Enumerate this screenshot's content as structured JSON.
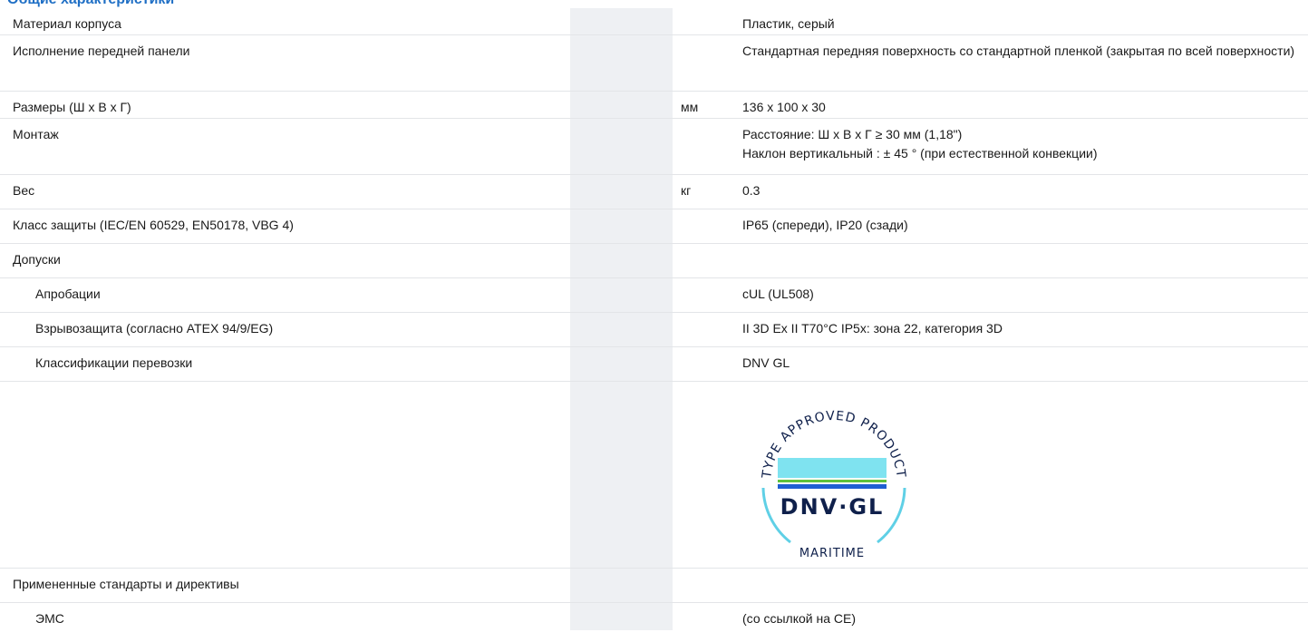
{
  "section_title": "Общие характеристики",
  "rows": [
    {
      "label": "Материал корпуса",
      "unit": "",
      "value": "Пластик, серый"
    },
    {
      "label": "Исполнение передней панели",
      "unit": "",
      "value": "Стандартная передняя поверхность со стандартной пленкой (закрытая по всей поверхности)"
    },
    {
      "label": "Размеры (Ш x В x Г)",
      "unit": "мм",
      "value": "136 x 100 x 30"
    },
    {
      "label": "Монтаж",
      "unit": "",
      "value": "Расстояние: Ш x В x Г ≥ 30 мм (1,18\")",
      "value2": "Наклон вертикальный : ± 45 ° (при естественной конвекции)"
    },
    {
      "label": "Вес",
      "unit": "кг",
      "value": "0.3"
    },
    {
      "label": "Класс защиты (IEC/EN 60529, EN50178, VBG 4)",
      "unit": "",
      "value": "IP65 (спереди), IP20 (сзади)"
    },
    {
      "label": "Допуски",
      "unit": "",
      "value": ""
    },
    {
      "label": "Апробации",
      "unit": "",
      "value": "cUL (UL508)"
    },
    {
      "label": "Взрывозащита (согласно ATEX 94/9/EG)",
      "unit": "",
      "value": "II 3D Ex II T70°C IP5x: зона 22, категория 3D"
    },
    {
      "label": "Классификации перевозки",
      "unit": "",
      "value": "DNV GL"
    },
    {
      "label": "Примененные стандарты и директивы",
      "unit": "",
      "value": ""
    },
    {
      "label": "ЭМС",
      "unit": "",
      "value": "(со ссылкой на CE)"
    }
  ],
  "logo": {
    "arc_text": "TYPE APPROVED PRODUCT",
    "brand": "DNV·GL",
    "bottom": "MARITIME",
    "colors": {
      "cyan": "#7fe3f0",
      "green": "#5fc23a",
      "blue": "#1f5fd1",
      "navy": "#0f204b",
      "ring": "#5fd0e6"
    }
  }
}
